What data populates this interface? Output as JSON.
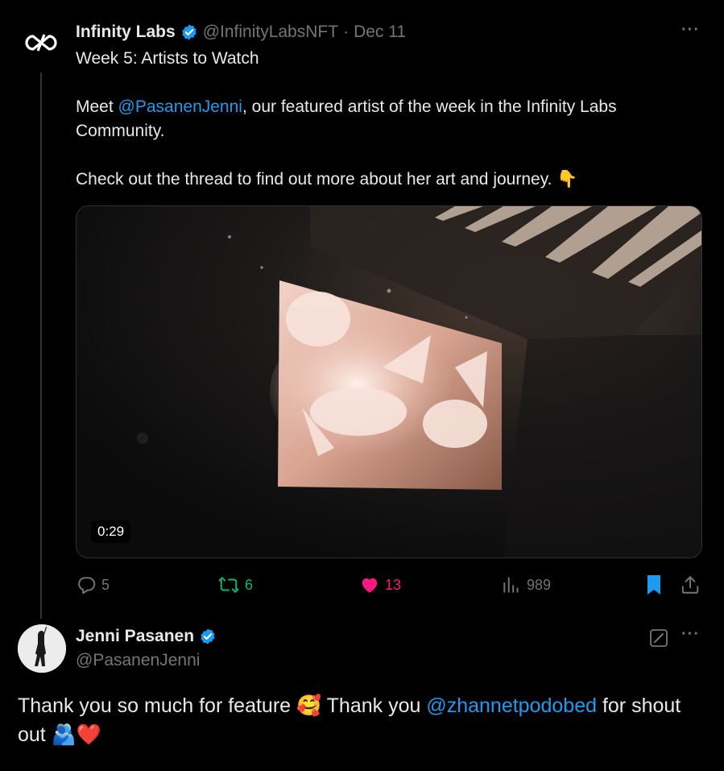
{
  "tweet": {
    "author_name": "Infinity Labs",
    "handle": "@InfinityLabsNFT",
    "separator": "·",
    "date": "Dec 11",
    "more_label": "···",
    "line1": "Week 5: Artists to Watch",
    "line2_prefix": "Meet ",
    "line2_mention": "@PasanenJenni",
    "line2_suffix": ", our featured artist of the week in the Infinity Labs Community.",
    "line3": "Check out the thread to find out more about her art and journey.",
    "line3_emoji": "👇",
    "video_duration": "0:29",
    "stats": {
      "replies": "5",
      "retweets": "6",
      "likes": "13",
      "views": "989"
    }
  },
  "reply": {
    "author_name": "Jenni Pasanen",
    "handle": "@PasanenJenni",
    "more_label": "···",
    "text_part1": "Thank you so much for feature ",
    "emoji1": "🥰",
    "text_part2": " Thank you ",
    "mention": "@zhannetpodobed",
    "text_part3": " for shout out ",
    "emoji2": "🫂",
    "emoji3": "❤️"
  },
  "colors": {
    "background": "#000000",
    "text": "#e7e9ea",
    "muted": "#71767b",
    "link": "#1d9bf0",
    "retweet": "#00ba7c",
    "like": "#f91880",
    "verified": "#1d9bf0"
  },
  "icons": {
    "infinity_logo": "infinity-logo-icon",
    "verified": "verified-badge-icon",
    "reply": "reply-icon",
    "retweet": "retweet-icon",
    "like": "heart-icon",
    "views": "views-icon",
    "bookmark": "bookmark-icon",
    "share": "share-icon",
    "edit": "edit-icon"
  }
}
